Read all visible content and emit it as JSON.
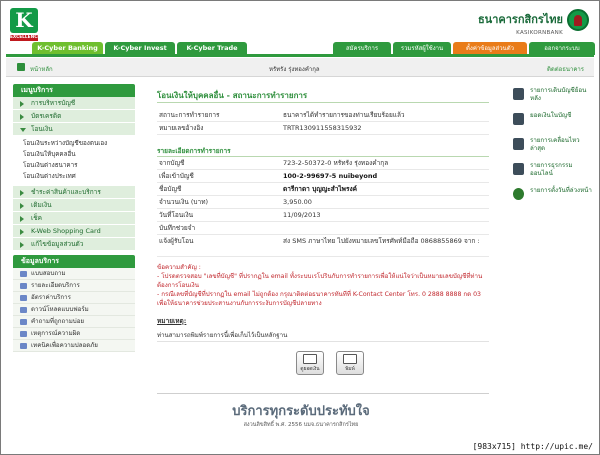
{
  "header": {
    "logo_letter": "K",
    "logo_tag": "EXCELLENCE",
    "bank_name_th": "ธนาคารกสิกรไทย",
    "bank_name_en": "KASIKORNBANK"
  },
  "nav": {
    "tabs": [
      {
        "label": "K-Cyber Banking",
        "active": true
      },
      {
        "label": "K-Cyber Invest",
        "active": false
      },
      {
        "label": "K-Cyber Trade",
        "active": false
      }
    ],
    "right_tabs": [
      "สมัครบริการ",
      "รวมรหัสผู้ใช้งาน",
      "ตั้งค่าข้อมูลส่วนตัว",
      "ออกจากระบบ"
    ]
  },
  "subbar": {
    "home_label": "หน้าหลัก",
    "user": "หรัทรัง รุ่งทองคำกุล",
    "contact": "ติดต่อธนาคาร"
  },
  "sidebar": {
    "menu_title": "เมนูบริการ",
    "items": [
      {
        "label": "การบริหารบัญชี",
        "open": false
      },
      {
        "label": "บัตรเครดิต",
        "open": false
      },
      {
        "label": "โอนเงิน",
        "open": true,
        "sub": [
          "โอนเงินระหว่างบัญชีของตนเอง",
          "โอนเงินให้บุคคลอื่น",
          "โอนเงินต่างธนาคาร",
          "โอนเงินต่างประเทศ"
        ]
      },
      {
        "label": "ชำระค่าสินค้าและบริการ",
        "open": false
      },
      {
        "label": "เติมเงิน",
        "open": false
      },
      {
        "label": "เช็ค",
        "open": false
      },
      {
        "label": "K-Web Shopping Card",
        "open": false
      },
      {
        "label": "แก้ไขข้อมูลส่วนตัว",
        "open": false
      }
    ],
    "service_title": "ข้อมูลบริการ",
    "services": [
      "แบบสอบถาม",
      "รายละเอียดบริการ",
      "อัตราค่าบริการ",
      "ดาวน์โหลดแบบฟอร์ม",
      "คำถามที่ถูกถามบ่อย",
      "เหตุการณ์ความผิด",
      "เทคนิคเพื่อความปลอดภัย"
    ]
  },
  "main": {
    "title": "โอนเงินให้บุคคลอื่น - สถานะการทำรายการ",
    "status_rows": [
      {
        "label": "สถานะการทำรายการ",
        "value": "ธนาคารได้ทำรายการของท่านเรียบร้อยแล้ว",
        "strong": false
      },
      {
        "label": "หมายเลขอ้างอิง",
        "value": "TRTR130911558315932",
        "strong": false
      }
    ],
    "detail_title": "รายละเอียดการทำรายการ",
    "detail_rows": [
      {
        "label": "จากบัญชี",
        "value": "723-2-50372-0 หรัทรัง รุ่งทองคำกุล",
        "strong": false
      },
      {
        "label": "เพื่อเข้าบัญชี",
        "value": "100-2-99697-5 nuibeyond",
        "strong": true
      },
      {
        "label": "ชื่อบัญชี",
        "value": "ดารีกาดา บุญญะสำไพรงค์",
        "strong": true
      },
      {
        "label": "จำนวนเงิน (บาท)",
        "value": "3,950.00",
        "strong": false
      },
      {
        "label": "วันที่โอนเงิน",
        "value": "11/09/2013",
        "strong": false
      },
      {
        "label": "บันทึกช่วยจำ",
        "value": "",
        "strong": false
      },
      {
        "label": "แจ้งผู้รับโอน",
        "value": "ส่ง SMS ภาษาไทย ไปยังหมายเลขโทรศัพท์มือถือ 0868855869 จาก :",
        "strong": false
      }
    ],
    "note_head": "ข้อความสำคัญ :",
    "note_1": "- โปรดตรวจสอบ \"เลขที่บัญชี\" ที่ปรากฏใน email ทั้งระบบเรโปรินกับการทำรายการเพื่อให้แน่ใจว่าเป็นหมายเลขบัญชีที่ท่านต้องการโอนเงิน",
    "note_2": "- กรณีเลขที่บัญชีที่ปรากฏใน email ไม่ถูกต้อง กรุณาติดต่อธนาคารทันทีที่ K-Contact Center โทร. 0 2888 8888 กด 03 เพื่อให้ธนาคารช่วยประสานงานกับการระงับการบัญชีปลายทาง",
    "remark_head": "หมายเหตุ:",
    "remark": "ท่านสามารถพิมพ์รายการนี้เพื่อเก็บไว้เป็นหลักฐาน",
    "actions": [
      "ดูยอดเงิน",
      "พิมพ์"
    ]
  },
  "right_panel": [
    "รายการเดินบัญชีย้อนหลัง",
    "ยอดเงินในบัญชี",
    "รายการเคลื่อนไหวล่าสุด",
    "รายการธุรกรรมออนไลน์",
    "รายการตั้งวันที่ล่วงหน้า"
  ],
  "footer": {
    "slogan": "บริการทุกระดับประทับใจ",
    "copyright": "สงวนลิขสิทธิ์ พ.ศ. 2556 บมจ.ธนาคารกสิกรไทย"
  },
  "watermark": "[983x715] http://upic.me/"
}
